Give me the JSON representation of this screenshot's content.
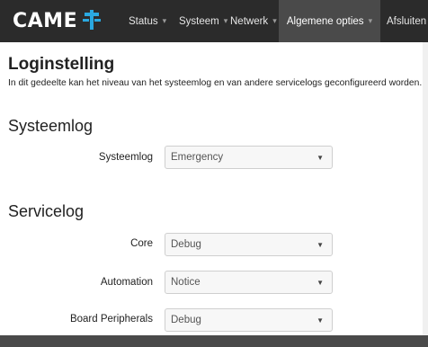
{
  "brand": {
    "name": "CAME"
  },
  "nav": {
    "items": [
      {
        "label": "Status",
        "caret": "▾"
      },
      {
        "label": "Systeem",
        "caret": "▾"
      },
      {
        "label": "Netwerk",
        "caret": "▾"
      },
      {
        "label": "Algemene opties",
        "caret": "▾"
      },
      {
        "label": "Afsluiten"
      }
    ],
    "active_index": 3
  },
  "page": {
    "title": "Loginstelling",
    "description": "In dit gedeelte kan het niveau van het systeemlog en van andere servicelogs geconfigureerd worden."
  },
  "sections": {
    "systeemlog": {
      "title": "Systeemlog",
      "rows": [
        {
          "label": "Systeemlog",
          "value": "Emergency"
        }
      ]
    },
    "servicelog": {
      "title": "Servicelog",
      "rows": [
        {
          "label": "Core",
          "value": "Debug"
        },
        {
          "label": "Automation",
          "value": "Notice"
        },
        {
          "label": "Board Peripherals",
          "value": "Debug"
        }
      ]
    }
  },
  "colors": {
    "navbar_bg": "#2b2b2b",
    "nav_active_bg": "#4a4a4a",
    "brand_accent": "#2aa8e0"
  }
}
